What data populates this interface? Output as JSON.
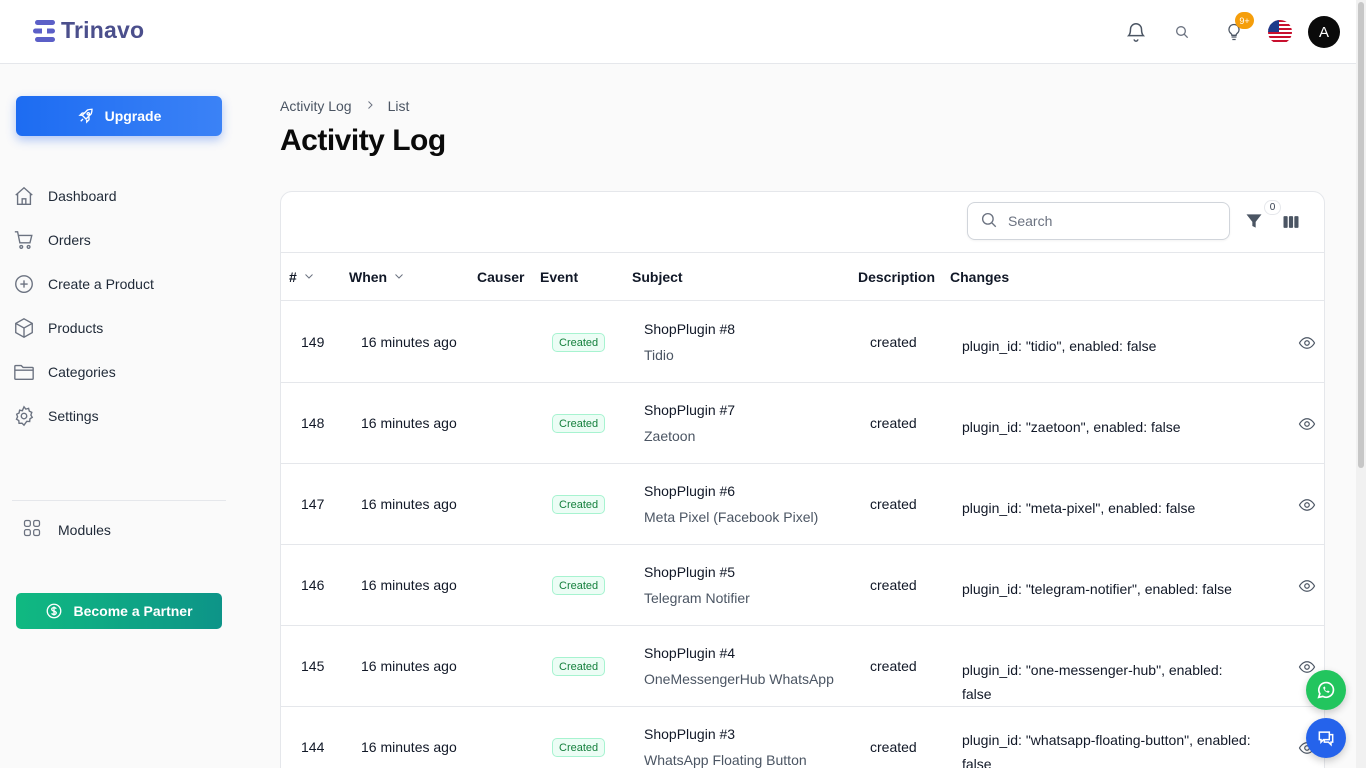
{
  "brand": {
    "name": "Trinavo"
  },
  "header": {
    "notification_count": "9+",
    "avatar_initial": "A"
  },
  "sidebar": {
    "upgrade_label": "Upgrade",
    "items": [
      {
        "label": "Dashboard",
        "icon": "home-icon"
      },
      {
        "label": "Orders",
        "icon": "cart-icon"
      },
      {
        "label": "Create a Product",
        "icon": "plus-circle-icon"
      },
      {
        "label": "Products",
        "icon": "box-icon"
      },
      {
        "label": "Categories",
        "icon": "folder-icon"
      },
      {
        "label": "Settings",
        "icon": "gear-icon"
      }
    ],
    "modules_label": "Modules",
    "partner_label": "Become a Partner"
  },
  "breadcrumb": {
    "root": "Activity Log",
    "current": "List"
  },
  "page": {
    "title": "Activity Log"
  },
  "toolbar": {
    "search_placeholder": "Search",
    "filter_count": "0"
  },
  "table": {
    "columns": [
      "#",
      "When",
      "Causer",
      "Event",
      "Subject",
      "Description",
      "Changes"
    ],
    "rows": [
      {
        "id": "149",
        "when": "16 minutes ago",
        "event": "Created",
        "subject": "ShopPlugin #8",
        "subject_name": "Tidio",
        "description": "created",
        "changes": "plugin_id: \"tidio\", enabled: false"
      },
      {
        "id": "148",
        "when": "16 minutes ago",
        "event": "Created",
        "subject": "ShopPlugin #7",
        "subject_name": "Zaetoon",
        "description": "created",
        "changes": "plugin_id: \"zaetoon\", enabled: false"
      },
      {
        "id": "147",
        "when": "16 minutes ago",
        "event": "Created",
        "subject": "ShopPlugin #6",
        "subject_name": "Meta Pixel (Facebook Pixel)",
        "description": "created",
        "changes": "plugin_id: \"meta-pixel\", enabled: false"
      },
      {
        "id": "146",
        "when": "16 minutes ago",
        "event": "Created",
        "subject": "ShopPlugin #5",
        "subject_name": "Telegram Notifier",
        "description": "created",
        "changes": "plugin_id: \"telegram-notifier\", enabled: false"
      },
      {
        "id": "145",
        "when": "16 minutes ago",
        "event": "Created",
        "subject": "ShopPlugin #4",
        "subject_name": "OneMessengerHub WhatsApp",
        "description": "created",
        "changes": "plugin_id: \"one-messenger-hub\", enabled: false"
      },
      {
        "id": "144",
        "when": "16 minutes ago",
        "event": "Created",
        "subject": "ShopPlugin #3",
        "subject_name": "WhatsApp Floating Button",
        "description": "created",
        "changes": "plugin_id: \"whatsapp-floating-button\", enabled: false"
      }
    ]
  },
  "colors": {
    "primary": "#2563eb",
    "success": "#10b981",
    "badge": "#f59e0b"
  }
}
